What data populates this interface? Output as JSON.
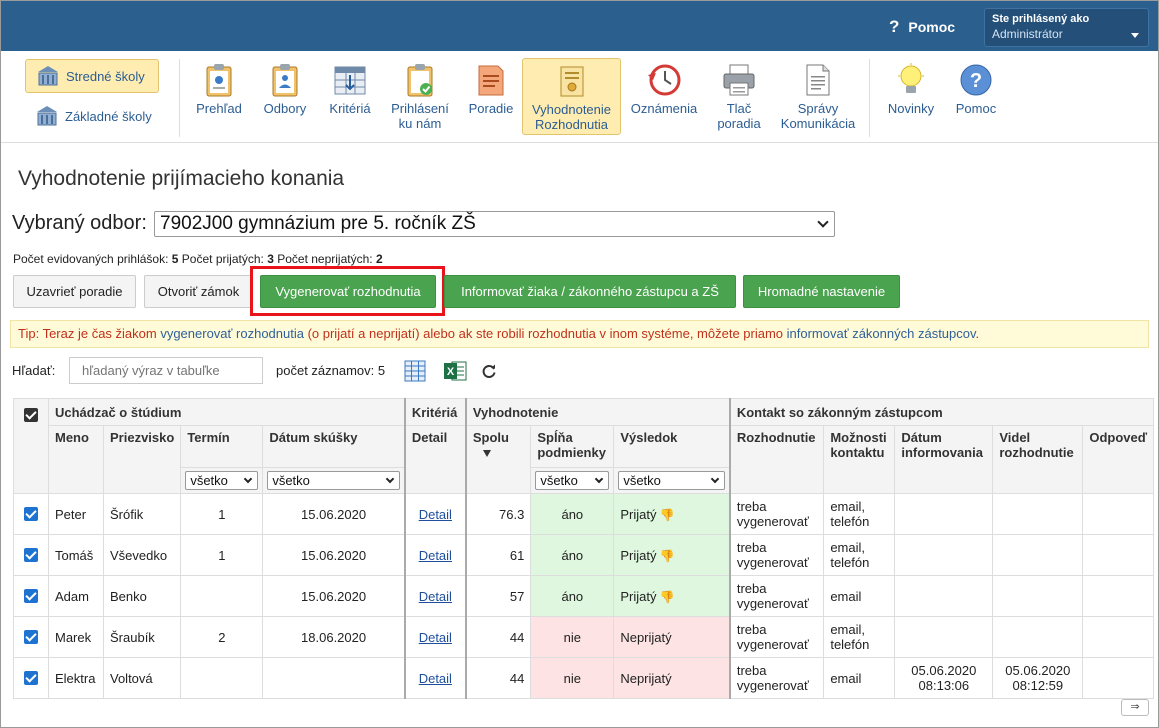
{
  "topbar": {
    "help_label": "Pomoc",
    "user_line1": "Ste prihlásený ako",
    "user_line2": "Administrátor"
  },
  "toolbar": {
    "schools": [
      {
        "label": "Stredné školy",
        "active": true
      },
      {
        "label": "Základné školy",
        "active": false
      }
    ],
    "tools": [
      {
        "line1": "Prehľad",
        "line2": ""
      },
      {
        "line1": "Odbory",
        "line2": ""
      },
      {
        "line1": "Kritériá",
        "line2": ""
      },
      {
        "line1": "Prihlásení",
        "line2": "ku nám"
      },
      {
        "line1": "Poradie",
        "line2": ""
      },
      {
        "line1": "Vyhodnotenie",
        "line2": "Rozhodnutia"
      },
      {
        "line1": "Oznámenia",
        "line2": ""
      },
      {
        "line1": "Tlač",
        "line2": "poradia"
      },
      {
        "line1": "Správy",
        "line2": "Komunikácia"
      },
      {
        "line1": "Novinky",
        "line2": ""
      },
      {
        "line1": "Pomoc",
        "line2": ""
      }
    ]
  },
  "page": {
    "title": "Vyhodnotenie prijímacieho konania",
    "odbor_label": "Vybraný odbor:",
    "odbor_value": "7902J00 gymnázium pre 5. ročník ZŠ",
    "count_label1": "Počet evidovaných prihlášok:",
    "count_value1": "5",
    "count_label2": "Počet prijatých:",
    "count_value2": "3",
    "count_label3": "Počet neprijatých:",
    "count_value3": "2"
  },
  "buttons": {
    "close_order": "Uzavrieť poradie",
    "open_lock": "Otvoriť zámok",
    "generate": "Vygenerovať rozhodnutia",
    "inform": "Informovať žiaka / zákonného zástupcu a ZŠ",
    "bulk": "Hromadné nastavenie"
  },
  "tip": {
    "prefix": "Tip: Teraz je čas žiakom ",
    "link1": "vygenerovať rozhodnutia",
    "middle": " (o prijatí a neprijatí) alebo ak ste robili rozhodnutia v inom systéme, môžete priamo ",
    "link2": "informovať zákonných zástupcov",
    "suffix": "."
  },
  "search": {
    "label": "Hľadať:",
    "placeholder": "hľadaný výraz v tabuľke",
    "count_label": "počet záznamov: 5"
  },
  "table": {
    "groups": {
      "applicant": "Uchádzač o štúdium",
      "criteria": "Kritériá",
      "evaluation": "Vyhodnotenie",
      "contact": "Kontakt so zákonným zástupcom"
    },
    "columns": {
      "first_name": "Meno",
      "last_name": "Priezvisko",
      "term": "Termín",
      "exam_date": "Dátum skúšky",
      "detail": "Detail",
      "total": "Spolu",
      "meets_l1": "Spĺňa",
      "meets_l2": "podmienky",
      "result": "Výsledok",
      "decision": "Rozhodnutie",
      "contact_l1": "Možnosti",
      "contact_l2": "kontaktu",
      "info_date_l1": "Dátum",
      "info_date_l2": "informovania",
      "seen_l1": "Videl",
      "seen_l2": "rozhodnutie",
      "answer": "Odpoveď"
    },
    "filters": {
      "term": "všetko",
      "exam_date": "všetko",
      "meets": "všetko",
      "result": "všetko"
    },
    "rows": [
      {
        "first": "Peter",
        "last": "Šrófik",
        "term": "1",
        "date": "15.06.2020",
        "detail": "Detail",
        "total": "76.3",
        "meets": "áno",
        "result": "Prijatý",
        "decision_l1": "treba",
        "decision_l2": "vygenerovať",
        "contact_l1": "email,",
        "contact_l2": "telefón",
        "info_l1": "",
        "info_l2": "",
        "seen_l1": "",
        "seen_l2": "",
        "answer": ""
      },
      {
        "first": "Tomáš",
        "last": "Vševedko",
        "term": "1",
        "date": "15.06.2020",
        "detail": "Detail",
        "total": "61",
        "meets": "áno",
        "result": "Prijatý",
        "decision_l1": "treba",
        "decision_l2": "vygenerovať",
        "contact_l1": "email,",
        "contact_l2": "telefón",
        "info_l1": "",
        "info_l2": "",
        "seen_l1": "",
        "seen_l2": "",
        "answer": ""
      },
      {
        "first": "Adam",
        "last": "Benko",
        "term": "",
        "date": "15.06.2020",
        "detail": "Detail",
        "total": "57",
        "meets": "áno",
        "result": "Prijatý",
        "decision_l1": "treba",
        "decision_l2": "vygenerovať",
        "contact_l1": "email",
        "contact_l2": "",
        "info_l1": "",
        "info_l2": "",
        "seen_l1": "",
        "seen_l2": "",
        "answer": ""
      },
      {
        "first": "Marek",
        "last": "Šraubík",
        "term": "2",
        "date": "18.06.2020",
        "detail": "Detail",
        "total": "44",
        "meets": "nie",
        "result": "Neprijatý",
        "decision_l1": "treba",
        "decision_l2": "vygenerovať",
        "contact_l1": "email,",
        "contact_l2": "telefón",
        "info_l1": "",
        "info_l2": "",
        "seen_l1": "",
        "seen_l2": "",
        "answer": ""
      },
      {
        "first": "Elektra",
        "last": "Voltová",
        "term": "",
        "date": "",
        "detail": "Detail",
        "total": "44",
        "meets": "nie",
        "result": "Neprijatý",
        "decision_l1": "treba",
        "decision_l2": "vygenerovať",
        "contact_l1": "email",
        "contact_l2": "",
        "info_l1": "05.06.2020",
        "info_l2": "08:13:06",
        "seen_l1": "05.06.2020",
        "seen_l2": "08:12:59",
        "answer": ""
      }
    ]
  },
  "scroll_button": "⇒"
}
